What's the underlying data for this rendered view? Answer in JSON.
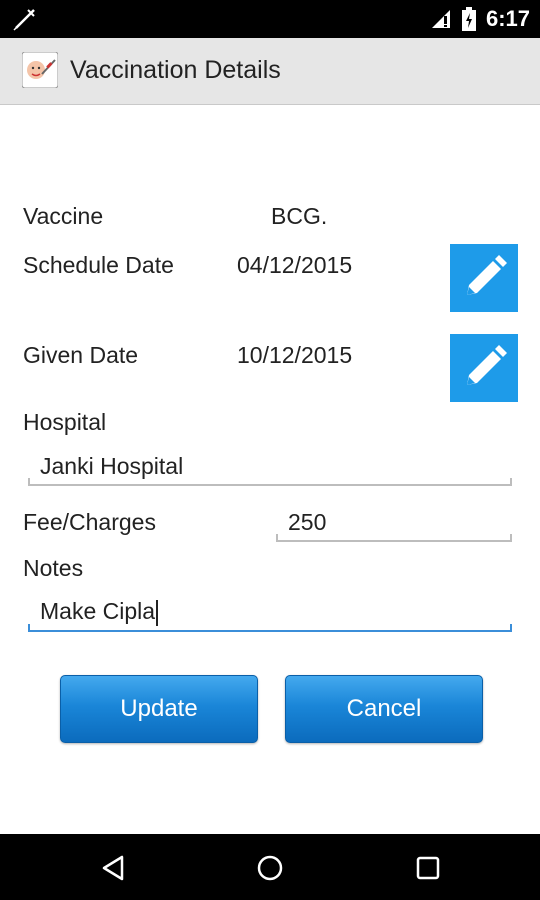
{
  "status_bar": {
    "time": "6:17",
    "icons": [
      "signal-icon",
      "battery-icon"
    ]
  },
  "app_bar": {
    "title": "Vaccination Details",
    "icon": "baby-vaccine-icon"
  },
  "details": {
    "vaccine_label": "Vaccine",
    "vaccine_value": "BCG.",
    "schedule_label": "Schedule Date",
    "schedule_value": "04/12/2015",
    "given_label": "Given Date",
    "given_value": "10/12/2015",
    "hospital_label": "Hospital",
    "hospital_value": "Janki Hospital",
    "fee_label": "Fee/Charges",
    "fee_value": "250",
    "notes_label": "Notes",
    "notes_value": "Make Cipla"
  },
  "buttons": {
    "update": "Update",
    "cancel": "Cancel"
  },
  "colors": {
    "accent": "#1e9be9",
    "button": "#1a86d8",
    "focus_line": "#3b8ed9"
  }
}
